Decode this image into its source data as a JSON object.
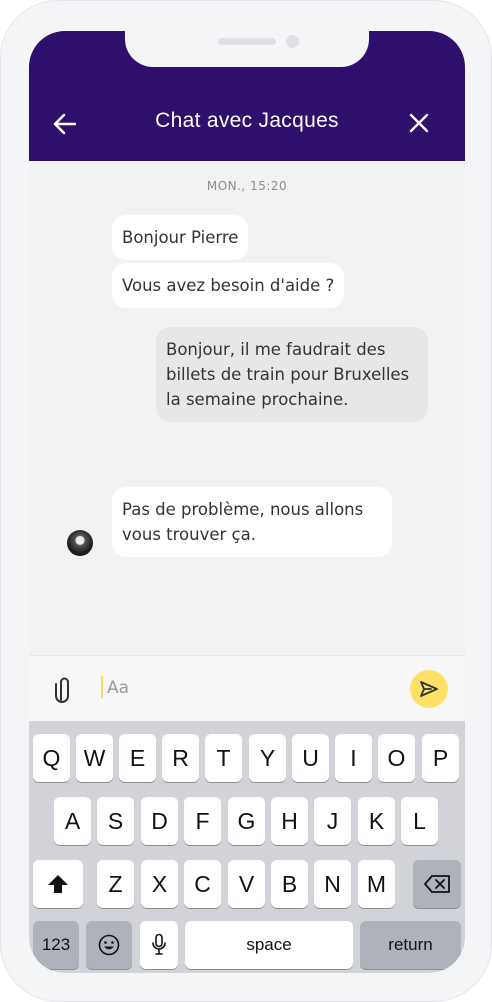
{
  "header": {
    "title": "Chat avec Jacques",
    "back_icon": "arrow-left-icon",
    "close_icon": "close-icon"
  },
  "chat": {
    "timestamp": "MON., 15:20",
    "messages": [
      {
        "from": "agent",
        "text": "Bonjour Pierre"
      },
      {
        "from": "agent",
        "text": "Vous avez besoin d'aide ?"
      },
      {
        "from": "user",
        "text": "Bonjour, il me faudrait des billets de train pour Bruxelles la semaine prochaine."
      },
      {
        "from": "agent",
        "text": "Pas de problème, nous allons vous trouver ça."
      }
    ]
  },
  "composer": {
    "placeholder": "Aa",
    "attach_icon": "paperclip-icon",
    "send_icon": "send-icon",
    "send_color": "#ffe066"
  },
  "keyboard": {
    "row1": [
      "Q",
      "W",
      "E",
      "R",
      "T",
      "Y",
      "U",
      "I",
      "O",
      "P"
    ],
    "row2": [
      "A",
      "S",
      "D",
      "F",
      "G",
      "H",
      "J",
      "K",
      "L"
    ],
    "row3": [
      "Z",
      "X",
      "C",
      "V",
      "B",
      "N",
      "M"
    ],
    "numbers_label": "123",
    "space_label": "space",
    "return_label": "return"
  },
  "colors": {
    "header_bg": "#2e0f6b",
    "chat_bg": "#f2f2f2",
    "keyboard_bg": "#d1d3d9"
  }
}
